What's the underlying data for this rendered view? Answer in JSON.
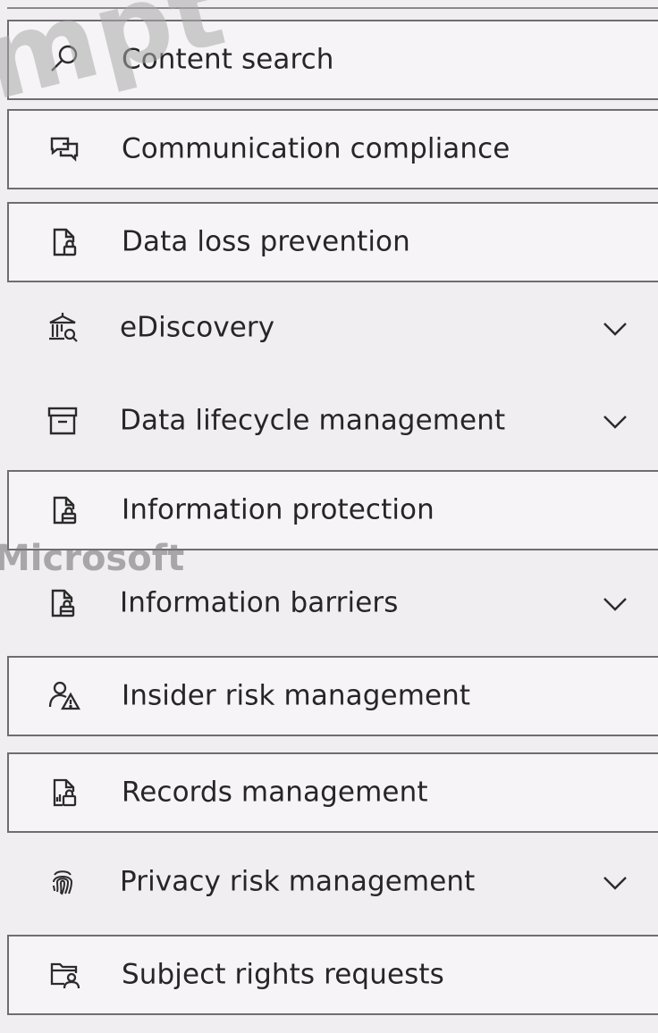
{
  "nav": {
    "items": [
      {
        "label": "Content search",
        "icon": "search-icon",
        "expandable": false
      },
      {
        "label": "Communication compliance",
        "icon": "chat-bubbles-icon",
        "expandable": false
      },
      {
        "label": "Data loss prevention",
        "icon": "document-lock-icon",
        "expandable": false
      },
      {
        "label": "eDiscovery",
        "icon": "courthouse-search-icon",
        "expandable": true
      },
      {
        "label": "Data lifecycle management",
        "icon": "archive-box-icon",
        "expandable": true
      },
      {
        "label": "Information protection",
        "icon": "document-lock-icon",
        "expandable": false
      },
      {
        "label": "Information barriers",
        "icon": "document-lock-icon",
        "expandable": true
      },
      {
        "label": "Insider risk management",
        "icon": "person-warning-icon",
        "expandable": false
      },
      {
        "label": "Records management",
        "icon": "document-chart-lock-icon",
        "expandable": false
      },
      {
        "label": "Privacy risk management",
        "icon": "fingerprint-icon",
        "expandable": true
      },
      {
        "label": "Subject rights requests",
        "icon": "folder-person-icon",
        "expandable": false
      }
    ]
  },
  "watermarks": {
    "overlay": "mpt",
    "brand": "Microsoft"
  },
  "colors": {
    "background": "#f1eef1",
    "border": "#6e6e6e",
    "text": "#262626"
  }
}
